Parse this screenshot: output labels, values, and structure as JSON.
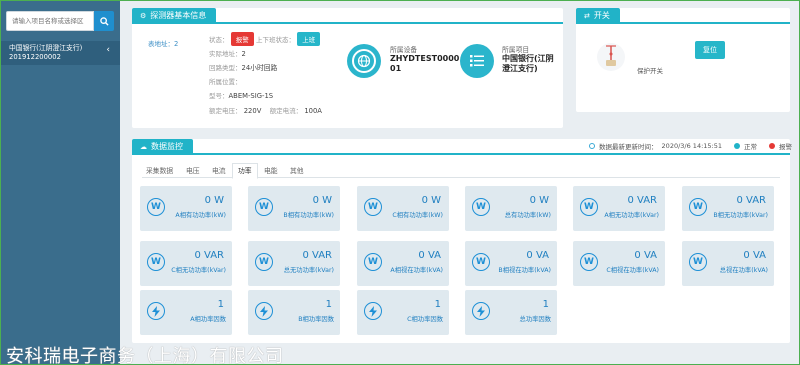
{
  "search": {
    "placeholder": "请输入项目名称或选择区"
  },
  "tree": {
    "line1": "中国银行(江阴澄江支行)",
    "line2": "201912200002"
  },
  "detector": {
    "title": "探测器基本信息",
    "meter_label": "表地址：",
    "meter_value": "2",
    "status_label": "状态：",
    "status_badge": "报警",
    "shift_label": "上下班状态：",
    "shift_badge": "上班",
    "actual_addr_label": "实际地址：",
    "actual_addr_value": "2",
    "loop_type_label": "回路类型：",
    "loop_type_value": "24小时回路",
    "location_label": "所属位置：",
    "location_value": "",
    "model_label": "型号：",
    "model_value": "ABEM-SIG-1S",
    "voltage_label": "额定电压：",
    "voltage_value": "220V",
    "current_label": "额定电流：",
    "current_value": "100A",
    "device_label": "所属设备",
    "device_value_1": "ZHYDTEST0000",
    "device_value_2": "01",
    "project_label": "所属项目",
    "project_value_1": "中国银行(江阴",
    "project_value_2": "澄江支行)"
  },
  "switch": {
    "title": "开关",
    "reset_label": "复位",
    "protect_label": "保护开关"
  },
  "monitor": {
    "title": "数据监控",
    "update_label": "数据最新更新时间：",
    "update_time": "2020/3/6 14:15:51",
    "normal_label": "正常",
    "alarm_label": "报警",
    "tabs": [
      "采集数据",
      "电压",
      "电流",
      "功率",
      "电能",
      "其他"
    ],
    "active_tab": "功率",
    "cards": [
      {
        "value": "0 W",
        "label": "A相有功功率(kW)",
        "icon": "W"
      },
      {
        "value": "0 W",
        "label": "B相有功功率(kW)",
        "icon": "W"
      },
      {
        "value": "0 W",
        "label": "C相有功功率(kW)",
        "icon": "W"
      },
      {
        "value": "0 W",
        "label": "总有功功率(kW)",
        "icon": "W"
      },
      {
        "value": "0 VAR",
        "label": "A相无功功率(kVar)",
        "icon": "W"
      },
      {
        "value": "0 VAR",
        "label": "B相无功功率(kVar)",
        "icon": "W"
      },
      {
        "value": "0 VAR",
        "label": "C相无功功率(kVar)",
        "icon": "W"
      },
      {
        "value": "0 VAR",
        "label": "总无功功率(kVar)",
        "icon": "W"
      },
      {
        "value": "0 VA",
        "label": "A相视在功率(kVA)",
        "icon": "W"
      },
      {
        "value": "0 VA",
        "label": "B相视在功率(kVA)",
        "icon": "W"
      },
      {
        "value": "0 VA",
        "label": "C相视在功率(kVA)",
        "icon": "W"
      },
      {
        "value": "0 VA",
        "label": "总视在功率(kVA)",
        "icon": "W"
      },
      {
        "value": "1",
        "label": "A相功率因数",
        "icon": "bolt"
      },
      {
        "value": "1",
        "label": "B相功率因数",
        "icon": "bolt"
      },
      {
        "value": "1",
        "label": "C相功率因数",
        "icon": "bolt"
      },
      {
        "value": "1",
        "label": "总功率因数",
        "icon": "bolt"
      }
    ]
  },
  "watermark": "安科瑞电子商务（上海）有限公司",
  "colors": {
    "accent": "#21b3c8",
    "sidebar": "#3a6d8c",
    "alarm": "#e53935",
    "card": "#dfe9ef",
    "value": "#1f7fc0"
  }
}
